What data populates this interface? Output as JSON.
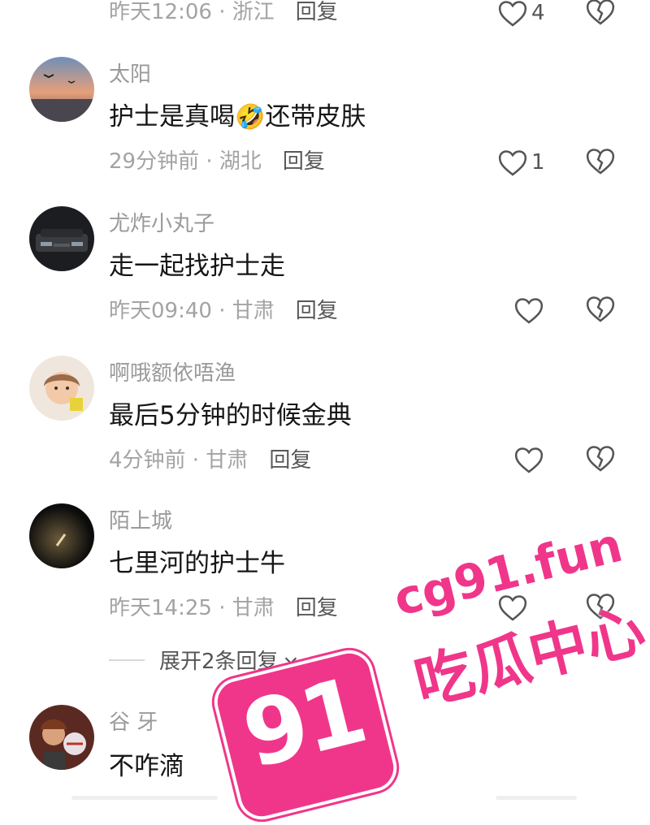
{
  "comments": [
    {
      "username": "",
      "text": "",
      "time": "昨天12:06",
      "region": "浙江",
      "reply_label": "回复",
      "likes": "4"
    },
    {
      "username": "太阳",
      "text": "护士是真喝",
      "emoji": "🤣",
      "text_after": "还带皮肤",
      "time": "29分钟前",
      "region": "湖北",
      "reply_label": "回复",
      "likes": "1"
    },
    {
      "username": "尤炸小丸子",
      "text": "走一起找护士走",
      "time": "昨天09:40",
      "region": "甘肃",
      "reply_label": "回复",
      "likes": ""
    },
    {
      "username": "啊哦额依唔渔",
      "text": "最后5分钟的时候金典",
      "time": "4分钟前",
      "region": "甘肃",
      "reply_label": "回复",
      "likes": ""
    },
    {
      "username": "陌上城",
      "text": "七里河的护士牛",
      "time": "昨天14:25",
      "region": "甘肃",
      "reply_label": "回复",
      "likes": ""
    },
    {
      "username": "谷 牙",
      "text": "不咋滴",
      "time": "",
      "region": "",
      "reply_label": "",
      "likes": ""
    }
  ],
  "expand_replies": {
    "label": "展开2条回复"
  },
  "watermark": {
    "number": "91",
    "url": "cg91.fun",
    "title": "吃瓜中心",
    "color": "#f0368a"
  },
  "separator": " · ",
  "icons": {
    "like": "heart-outline-icon",
    "dislike": "broken-heart-icon",
    "expand": "chevron-down-icon"
  }
}
